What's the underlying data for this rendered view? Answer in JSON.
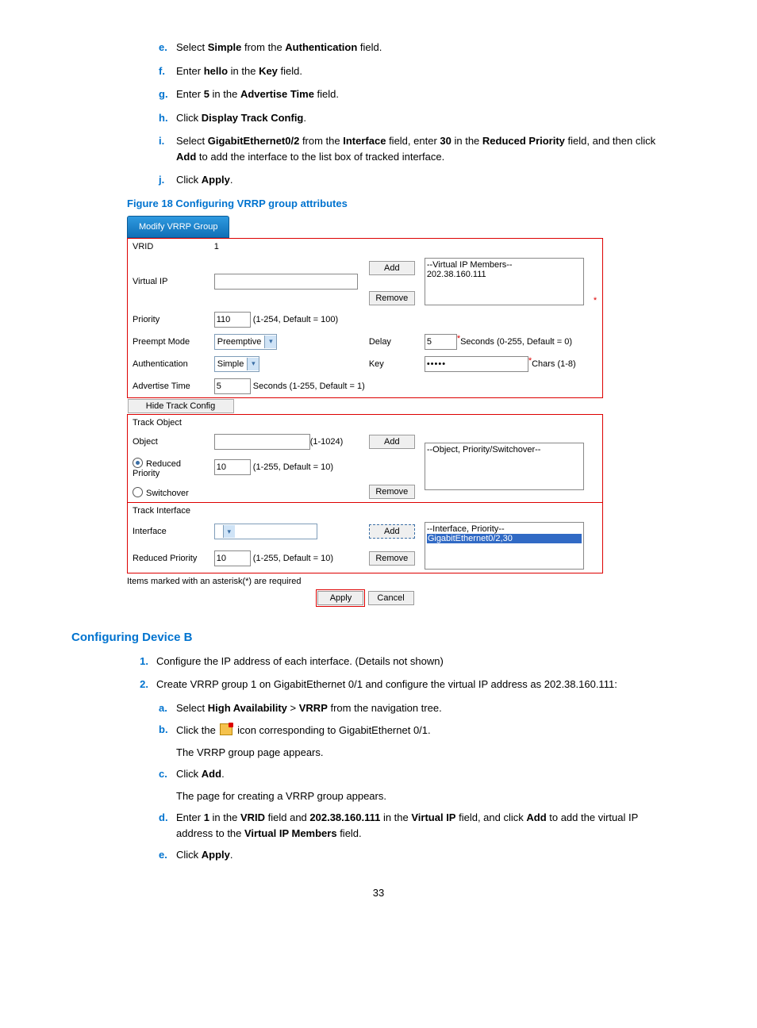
{
  "steps_top": [
    {
      "m": "e.",
      "pre": "Select ",
      "b1": "Simple",
      "mid": " from the ",
      "b2": "Authentication",
      "post": " field."
    },
    {
      "m": "f.",
      "pre": "Enter ",
      "b1": "hello",
      "mid": " in the ",
      "b2": "Key",
      "post": " field."
    },
    {
      "m": "g.",
      "pre": "Enter ",
      "b1": "5",
      "mid": " in the ",
      "b2": "Advertise Time",
      "post": " field."
    },
    {
      "m": "h.",
      "pre": "Click ",
      "b1": "Display Track Config",
      "mid": "",
      "b2": "",
      "post": "."
    },
    {
      "m": "i.",
      "pre": "Select ",
      "b1": "GigabitEthernet0/2",
      "mid": " from the ",
      "b2": "Interface",
      "post": " field, enter ",
      "b3": "30",
      "mid2": " in the ",
      "b4": "Reduced Priority",
      "post2": " field, and then click ",
      "b5": "Add",
      "post3": " to add the interface to the list box of tracked interface."
    },
    {
      "m": "j.",
      "pre": "Click ",
      "b1": "Apply",
      "mid": "",
      "b2": "",
      "post": "."
    }
  ],
  "figure_caption": "Figure 18 Configuring VRRP group attributes",
  "vrrp": {
    "tab": "Modify VRRP Group",
    "vrid_label": "VRID",
    "vrid_value": "1",
    "virtualip_label": "Virtual IP",
    "add_btn": "Add",
    "remove_btn": "Remove",
    "members_header": "--Virtual IP Members--",
    "members_item": "202.38.160.111",
    "priority_label": "Priority",
    "priority_value": "110",
    "priority_hint": "(1-254, Default = 100)",
    "preempt_label": "Preempt Mode",
    "preempt_value": "Preemptive",
    "delay_label": "Delay",
    "delay_value": "5",
    "delay_hint": "Seconds (0-255, Default = 0)",
    "auth_label": "Authentication",
    "auth_value": "Simple",
    "key_label": "Key",
    "key_value": "•••••",
    "key_hint": "Chars (1-8)",
    "advtime_label": "Advertise Time",
    "advtime_value": "5",
    "advtime_hint": "Seconds (1-255, Default = 1)",
    "hide_track": "Hide Track Config",
    "track_obj_header": "Track Object",
    "object_label": "Object",
    "object_hint": "(1-1024)",
    "object_list_header": "--Object, Priority/Switchover--",
    "reduced_prio_radio": "Reduced Priority",
    "reduced_prio_val": "10",
    "reduced_prio_hint": "(1-255, Default = 10)",
    "switchover_radio": "Switchover",
    "track_if_header": "Track Interface",
    "interface_label": "Interface",
    "interface_list_header": "--Interface, Priority--",
    "interface_list_item": "GigabitEthernet0/2,30",
    "if_reduced_label": "Reduced Priority",
    "if_reduced_val": "10",
    "if_reduced_hint": "(1-255, Default = 10)",
    "required_note": "Items marked with an asterisk(*) are required",
    "apply_btn": "Apply",
    "cancel_btn": "Cancel"
  },
  "h3": "Configuring Device B",
  "num_steps": [
    {
      "m": "1.",
      "text": "Configure the IP address of each interface. (Details not shown)"
    },
    {
      "m": "2.",
      "text": "Create VRRP group 1 on GigabitEthernet 0/1 and configure the virtual IP address as 202.38.160.111:"
    }
  ],
  "sub_steps": {
    "a": {
      "pre": "Select ",
      "b1": "High Availability",
      "mid": " > ",
      "b2": "VRRP",
      "post": " from the navigation tree."
    },
    "b": {
      "pre": "Click the ",
      "post": " icon corresponding to GigabitEthernet 0/1.",
      "cont": "The VRRP group page appears."
    },
    "c": {
      "pre": "Click ",
      "b1": "Add",
      "post": ".",
      "cont": "The page for creating a VRRP group appears."
    },
    "d": {
      "pre": "Enter ",
      "b1": "1",
      "mid": " in the ",
      "b2": "VRID",
      "mid2": " field and ",
      "b3": "202.38.160.111",
      "mid3": " in the ",
      "b4": "Virtual IP",
      "mid4": " field, and click ",
      "b5": "Add",
      "mid5": " to add the virtual IP address to the ",
      "b6": "Virtual IP Members",
      "post": " field."
    },
    "e": {
      "pre": "Click ",
      "b1": "Apply",
      "post": "."
    }
  },
  "pagenum": "33"
}
